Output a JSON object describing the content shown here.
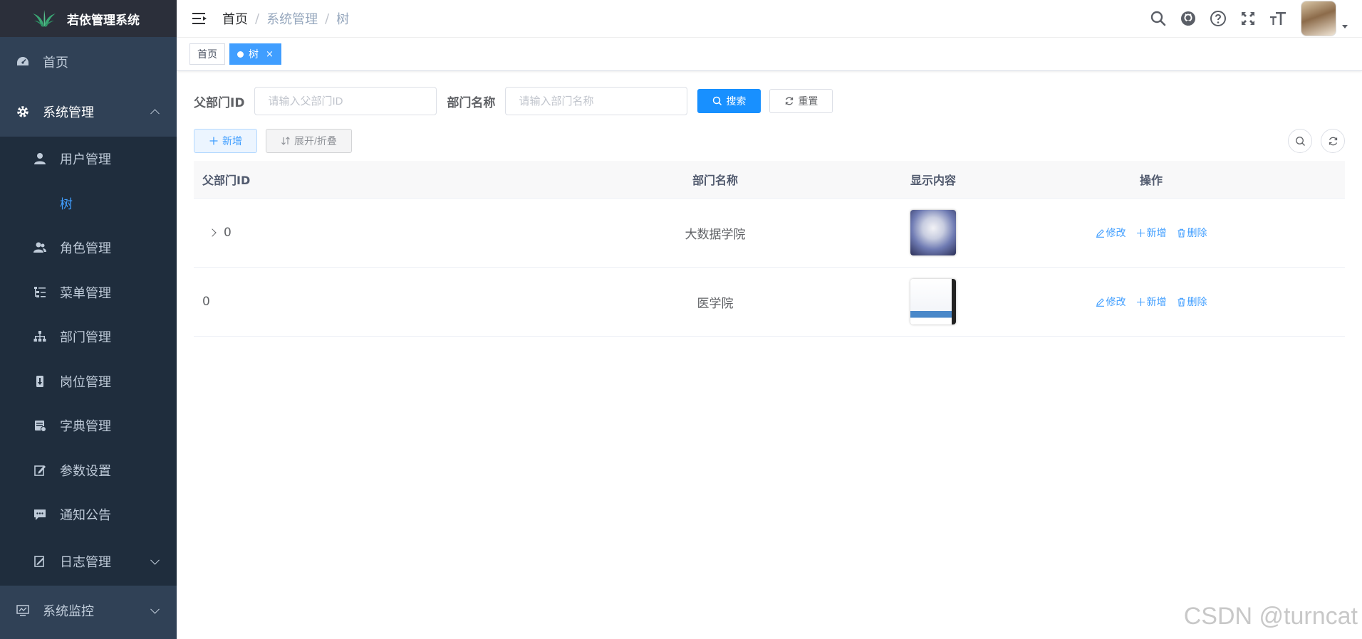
{
  "app": {
    "title": "若依管理系统"
  },
  "sidebar": {
    "items": [
      {
        "label": "首页",
        "icon": "dashboard-icon"
      },
      {
        "label": "系统管理",
        "icon": "gear-icon",
        "expanded": true
      },
      {
        "label": "系统监控",
        "icon": "monitor-icon",
        "expanded": false
      }
    ],
    "submenu": [
      {
        "label": "用户管理",
        "icon": "user-icon"
      },
      {
        "label": "树",
        "icon": "",
        "active": true
      },
      {
        "label": "角色管理",
        "icon": "peoples-icon"
      },
      {
        "label": "菜单管理",
        "icon": "tree-table-icon"
      },
      {
        "label": "部门管理",
        "icon": "tree-icon"
      },
      {
        "label": "岗位管理",
        "icon": "post-icon"
      },
      {
        "label": "字典管理",
        "icon": "dict-icon"
      },
      {
        "label": "参数设置",
        "icon": "edit-icon"
      },
      {
        "label": "通知公告",
        "icon": "message-icon"
      },
      {
        "label": "日志管理",
        "icon": "log-icon",
        "expanded": false
      }
    ]
  },
  "navbar": {
    "breadcrumb": [
      "首页",
      "系统管理",
      "树"
    ]
  },
  "tags": [
    {
      "label": "首页",
      "active": false
    },
    {
      "label": "树",
      "active": true,
      "close": "×"
    }
  ],
  "search": {
    "parent_label": "父部门ID",
    "parent_placeholder": "请输入父部门ID",
    "name_label": "部门名称",
    "name_placeholder": "请输入部门名称",
    "search_button": "搜索",
    "reset_button": "重置"
  },
  "toolbar": {
    "add_button": "新增",
    "toggle_button": "展开/折叠"
  },
  "table": {
    "headers": [
      "父部门ID",
      "部门名称",
      "显示内容",
      "操作"
    ],
    "rows": [
      {
        "parent_id": "0",
        "name": "大数据学院",
        "has_children": true
      },
      {
        "parent_id": "0",
        "name": "医学院",
        "has_children": false
      }
    ],
    "actions": {
      "edit": "修改",
      "add": "新增",
      "delete": "删除"
    }
  },
  "watermark": "CSDN @turncat",
  "colors": {
    "primary": "#1890ff",
    "link": "#409eff",
    "sidebar_bg": "#304156",
    "submenu_bg": "#1f2d3d"
  }
}
